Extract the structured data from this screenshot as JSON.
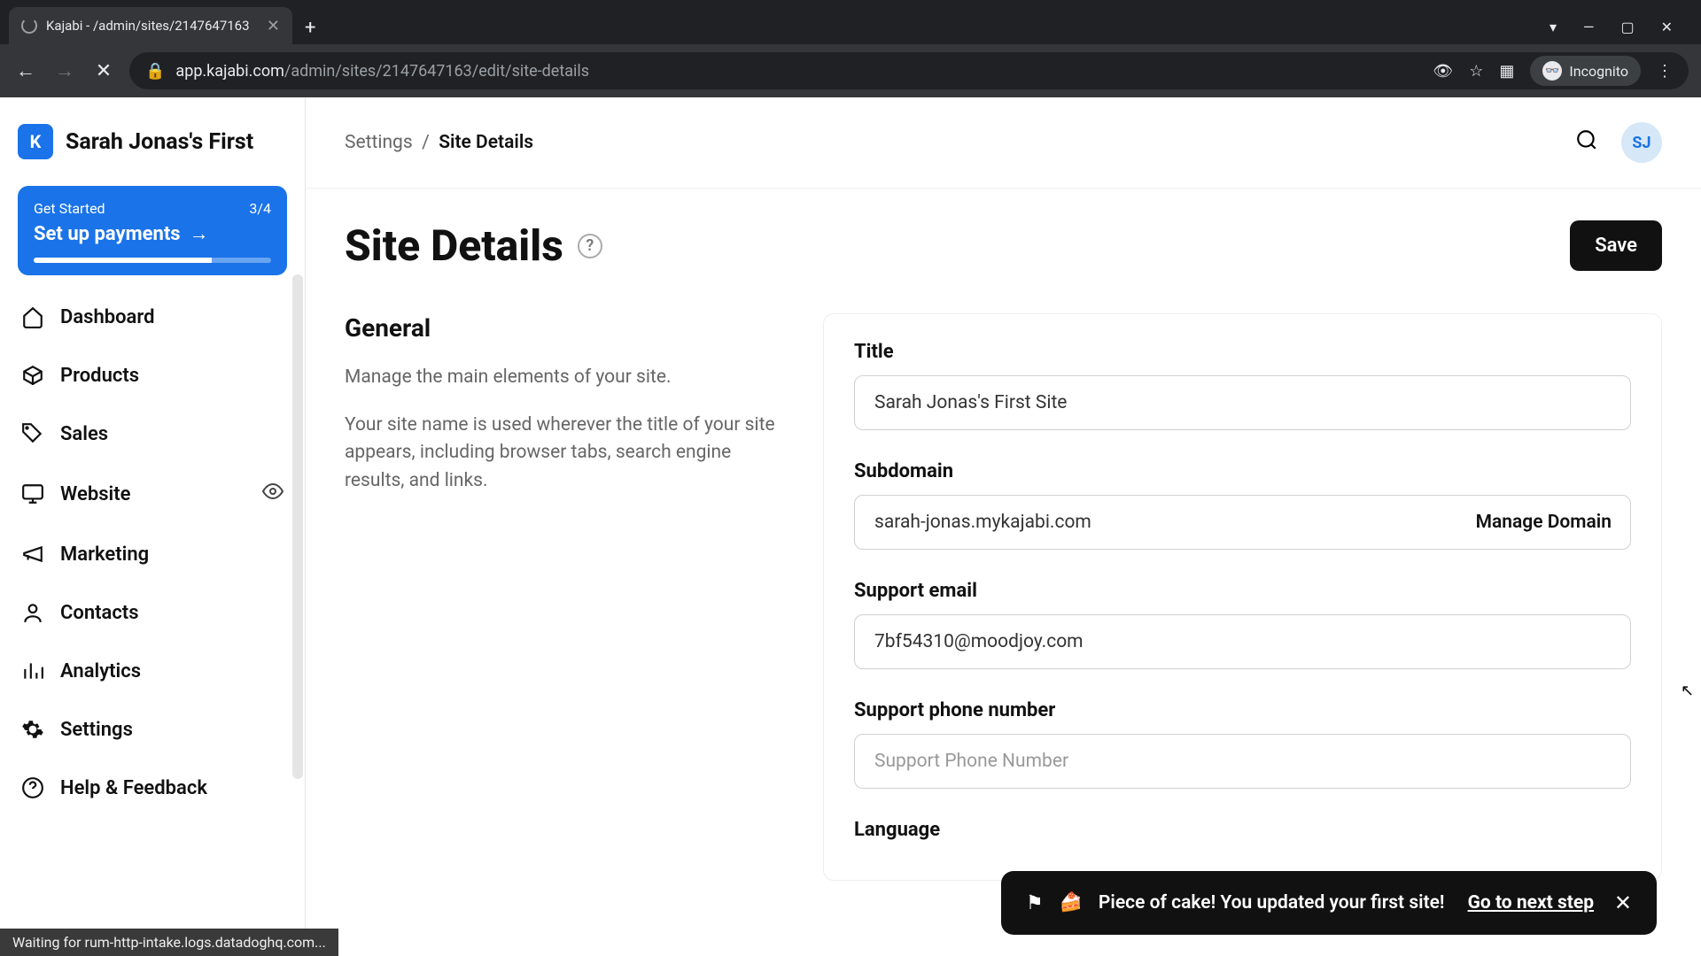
{
  "browser": {
    "tab_title": "Kajabi - /admin/sites/2147647163",
    "url_domain": "app.kajabi.com",
    "url_path": "/admin/sites/2147647163/edit/site-details",
    "incognito_label": "Incognito",
    "status_text": "Waiting for rum-http-intake.logs.datadoghq.com..."
  },
  "sidebar": {
    "brand_name": "Sarah Jonas's First",
    "get_started": {
      "label": "Get Started",
      "counter": "3/4",
      "cta": "Set up payments"
    },
    "items": [
      {
        "label": "Dashboard"
      },
      {
        "label": "Products"
      },
      {
        "label": "Sales"
      },
      {
        "label": "Website"
      },
      {
        "label": "Marketing"
      },
      {
        "label": "Contacts"
      },
      {
        "label": "Analytics"
      },
      {
        "label": "Settings"
      },
      {
        "label": "Help & Feedback"
      }
    ]
  },
  "header": {
    "breadcrumb_root": "Settings",
    "breadcrumb_current": "Site Details",
    "avatar_initials": "SJ"
  },
  "page": {
    "title": "Site Details",
    "save_label": "Save",
    "section_title": "General",
    "section_desc1": "Manage the main elements of your site.",
    "section_desc2": "Your site name is used wherever the title of your site appears, including browser tabs, search engine results, and links."
  },
  "form": {
    "title_label": "Title",
    "title_value": "Sarah Jonas's First Site",
    "subdomain_label": "Subdomain",
    "subdomain_value": "sarah-jonas.mykajabi.com",
    "manage_domain": "Manage Domain",
    "support_email_label": "Support email",
    "support_email_value": "7bf54310@moodjoy.com",
    "support_phone_label": "Support phone number",
    "support_phone_placeholder": "Support Phone Number",
    "language_label": "Language"
  },
  "toast": {
    "emoji": "🍰",
    "message": "Piece of cake! You updated your first site!",
    "link": "Go to next step"
  }
}
